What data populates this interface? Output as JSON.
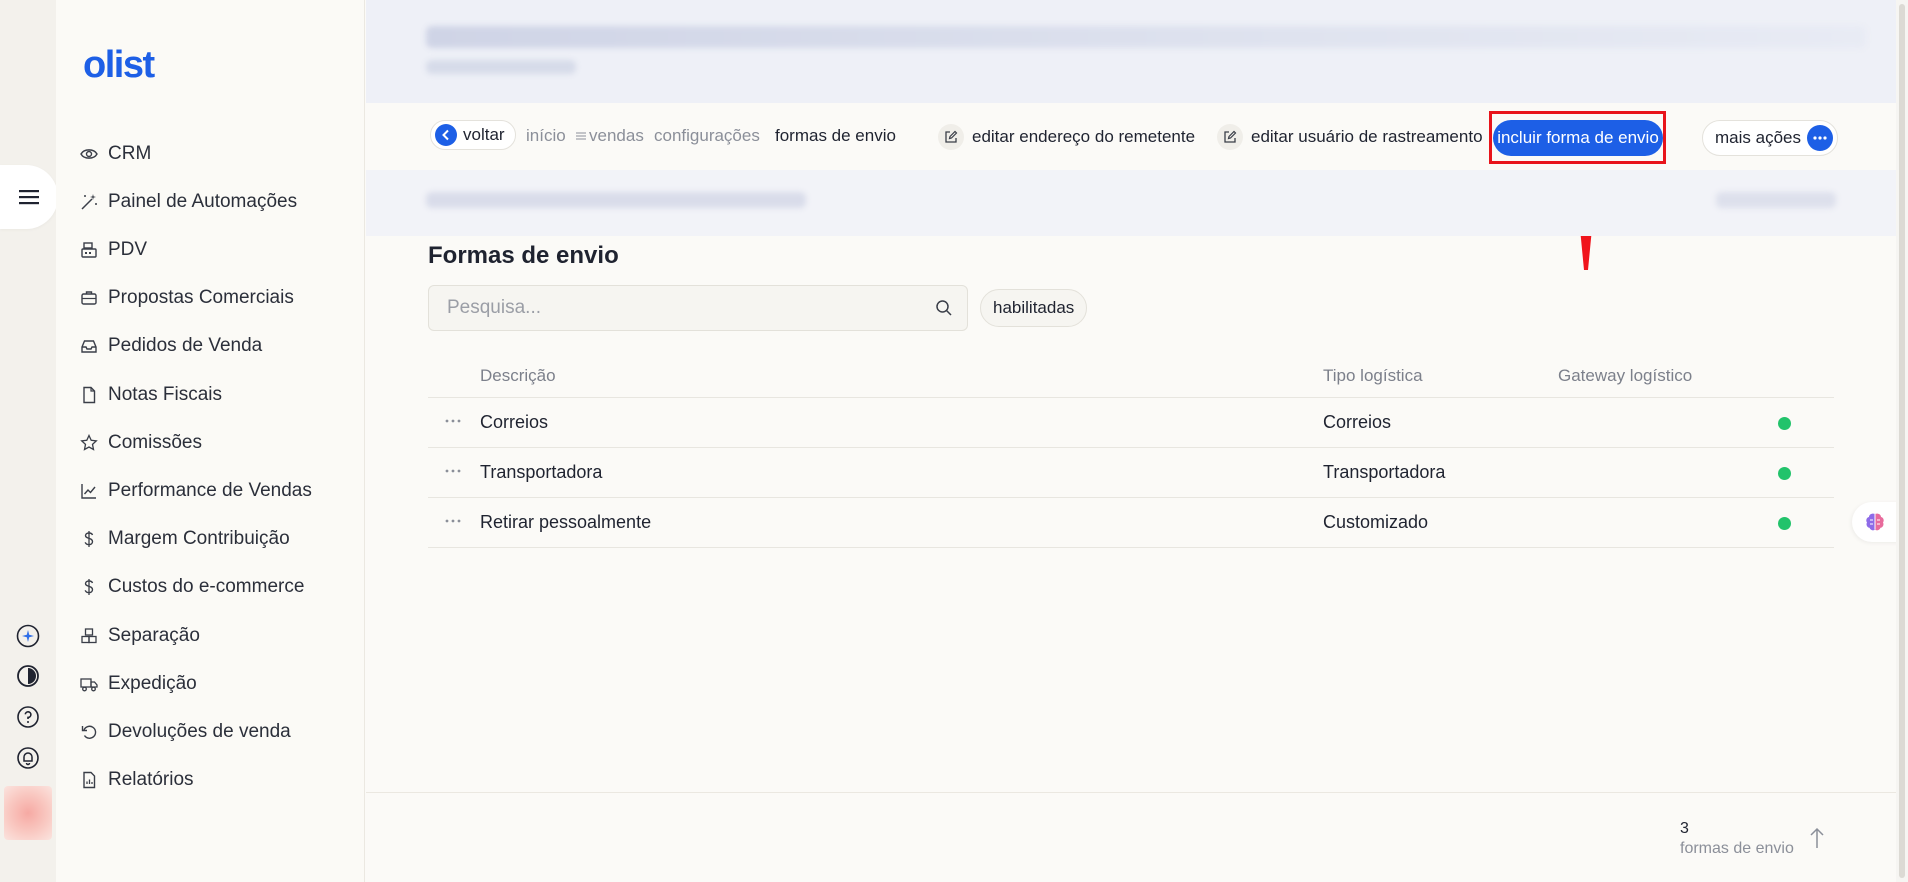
{
  "app": {
    "logo": "olist"
  },
  "sidebar": {
    "items": [
      {
        "label": "CRM",
        "icon": "eye-icon"
      },
      {
        "label": "Painel de Automações",
        "icon": "magic-wand-icon"
      },
      {
        "label": "PDV",
        "icon": "cash-register-icon"
      },
      {
        "label": "Propostas Comerciais",
        "icon": "briefcase-icon"
      },
      {
        "label": "Pedidos de Venda",
        "icon": "inbox-icon"
      },
      {
        "label": "Notas Fiscais",
        "icon": "file-icon"
      },
      {
        "label": "Comissões",
        "icon": "star-icon"
      },
      {
        "label": "Performance de Vendas",
        "icon": "trend-chart-icon"
      },
      {
        "label": "Margem Contribuição",
        "icon": "dollar-icon"
      },
      {
        "label": "Custos do e-commerce",
        "icon": "dollar-icon"
      },
      {
        "label": "Separação",
        "icon": "boxes-icon"
      },
      {
        "label": "Expedição",
        "icon": "truck-icon"
      },
      {
        "label": "Devoluções de venda",
        "icon": "undo-icon"
      },
      {
        "label": "Relatórios",
        "icon": "report-icon"
      }
    ]
  },
  "breadcrumb": {
    "back_label": "voltar",
    "items": [
      {
        "label": "início"
      },
      {
        "label": "vendas"
      },
      {
        "label": "configurações"
      },
      {
        "label": "formas de envio",
        "current": true
      }
    ]
  },
  "actions": {
    "edit_sender_address": "editar endereço do remetente",
    "edit_tracking_user": "editar usuário de rastreamento",
    "primary": "incluir forma de envio",
    "more": "mais ações"
  },
  "page": {
    "title": "Formas de envio",
    "search_placeholder": "Pesquisa...",
    "filter_chip": "habilitadas"
  },
  "table": {
    "columns": [
      "Descrição",
      "Tipo logística",
      "Gateway logístico"
    ],
    "rows": [
      {
        "descricao": "Correios",
        "tipo": "Correios",
        "gateway": "",
        "status": "enabled"
      },
      {
        "descricao": "Transportadora",
        "tipo": "Transportadora",
        "gateway": "",
        "status": "enabled"
      },
      {
        "descricao": "Retirar pessoalmente",
        "tipo": "Customizado",
        "gateway": "",
        "status": "enabled"
      }
    ]
  },
  "footer": {
    "count": "3",
    "label": "formas de envio"
  },
  "colors": {
    "brand": "#1d5fe6",
    "highlight": "#e8141b",
    "status_enabled": "#22c36b"
  }
}
